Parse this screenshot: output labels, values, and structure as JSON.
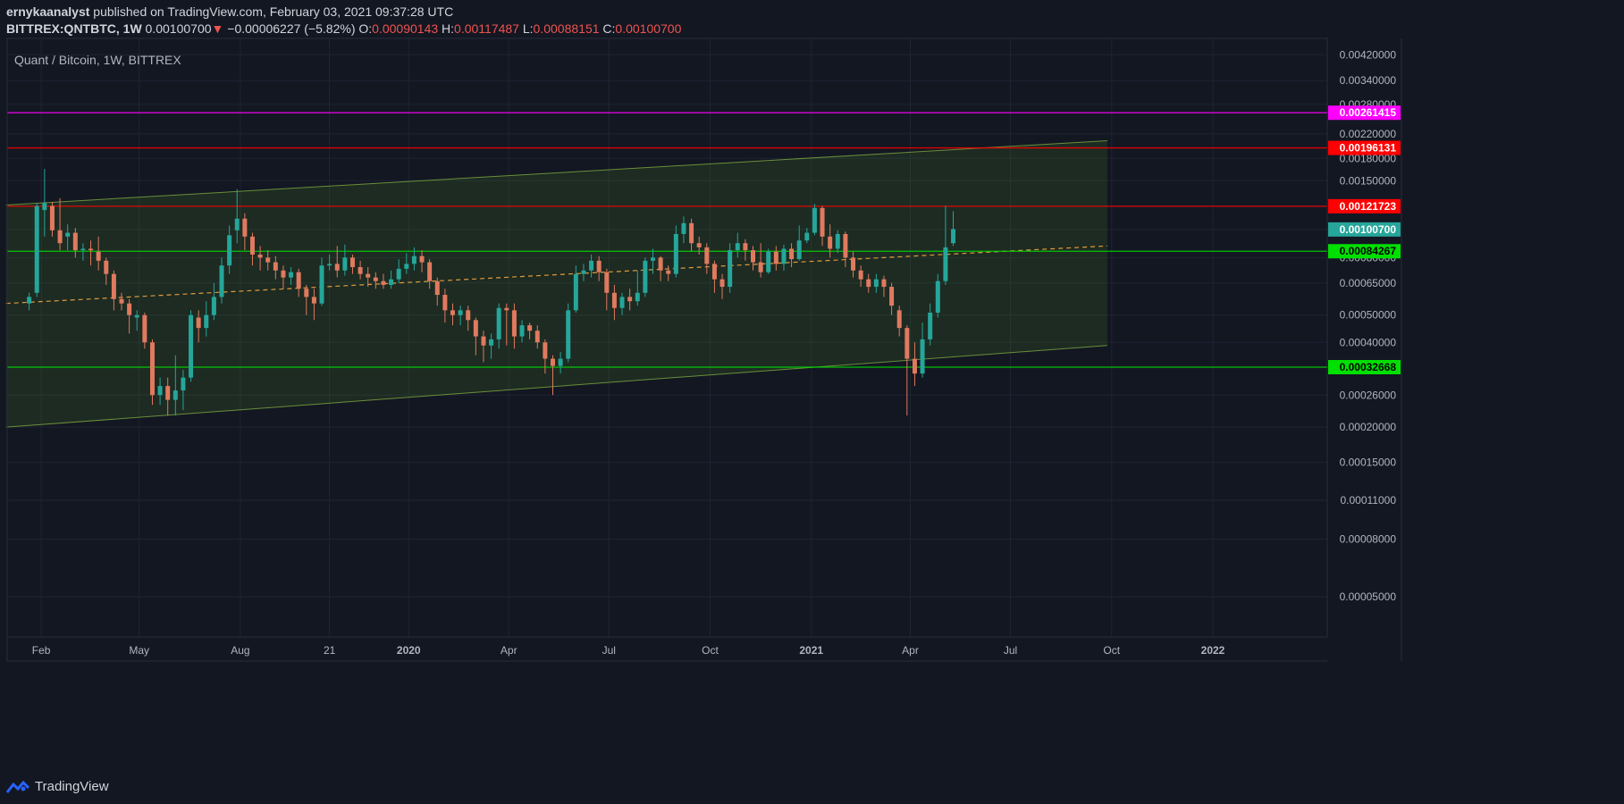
{
  "header": {
    "author": "ernykaanalyst",
    "published_text": "published on TradingView.com, February 03, 2021 09:37:28 UTC",
    "symbol": "BITTREX:QNTBTC, 1W",
    "last": "0.00100700",
    "change": "−0.00006227 (−5.82%)",
    "o_label": "O:",
    "o": "0.00090143",
    "h_label": "H:",
    "h": "0.00117487",
    "l_label": "L:",
    "l": "0.00088151",
    "c_label": "C:",
    "c": "0.00100700"
  },
  "chart_title": "Quant / Bitcoin, 1W, BITTREX",
  "footer": {
    "brand": "TradingView"
  },
  "colors": {
    "bg": "#131722",
    "up": "#26a69a",
    "down": "#e07a5f",
    "grid": "#1f2433",
    "text": "#b2b5be",
    "channel": "#6a8f3a",
    "mid": "#e09b3d",
    "magenta": "#ff00ff",
    "red": "#ff0000",
    "green": "#00e000",
    "price": "#26a69a"
  },
  "chart_data": {
    "type": "candlestick",
    "scale": "log",
    "ylim": [
      3.6e-05,
      0.0048
    ],
    "ylabels": [
      "0.00420000",
      "0.00340000",
      "0.00280000",
      "0.00220000",
      "0.00180000",
      "0.00150000",
      "0.00121723",
      "0.00100700",
      "0.00080000",
      "0.00065000",
      "0.00050000",
      "0.00040000",
      "0.00032668",
      "0.00026000",
      "0.00020000",
      "0.00015000",
      "0.00011000",
      "0.00008000",
      "0.00005000"
    ],
    "xaxis": {
      "range": [
        "2019-01-01",
        "2022-04-15"
      ],
      "ticks": [
        {
          "label": "Feb",
          "date": "2019-02-01",
          "bold": false
        },
        {
          "label": "May",
          "date": "2019-05-01",
          "bold": false
        },
        {
          "label": "Aug",
          "date": "2019-08-01",
          "bold": false
        },
        {
          "label": "21",
          "date": "2019-10-21",
          "bold": false
        },
        {
          "label": "2020",
          "date": "2020-01-01",
          "bold": true
        },
        {
          "label": "Apr",
          "date": "2020-04-01",
          "bold": false
        },
        {
          "label": "Jul",
          "date": "2020-07-01",
          "bold": false
        },
        {
          "label": "Oct",
          "date": "2020-10-01",
          "bold": false
        },
        {
          "label": "2021",
          "date": "2021-01-01",
          "bold": true
        },
        {
          "label": "Apr",
          "date": "2021-04-01",
          "bold": false
        },
        {
          "label": "Jul",
          "date": "2021-07-01",
          "bold": false
        },
        {
          "label": "Oct",
          "date": "2021-10-01",
          "bold": false
        },
        {
          "label": "2022",
          "date": "2022-01-01",
          "bold": true
        }
      ]
    },
    "levels": [
      {
        "value": 0.00261415,
        "label": "0.00261415",
        "color": "#ff00ff"
      },
      {
        "value": 0.00196131,
        "label": "0.00196131",
        "color": "#ff0000"
      },
      {
        "value": 0.00121723,
        "label": "0.00121723",
        "color": "#ff0000"
      },
      {
        "value": 0.00084267,
        "label": "0.00084267",
        "color": "#00e000"
      },
      {
        "value": 0.00032668,
        "label": "0.00032668",
        "color": "#00e000"
      }
    ],
    "current_price": {
      "value": 0.001007,
      "label": "0.00100700"
    },
    "channel": {
      "start": "2018-12-31",
      "end": "2021-09-27",
      "upper": [
        0.00123,
        0.00208
      ],
      "lower": [
        0.0002,
        0.00039
      ],
      "mid": [
        0.00055,
        0.00088
      ]
    },
    "candles_start": "2019-01-21",
    "candles": [
      [
        0.00055,
        0.00058,
        0.00052,
        0.0006
      ],
      [
        0.0006,
        0.00122,
        0.00058,
        0.00125
      ],
      [
        0.00118,
        0.00125,
        0.00095,
        0.00165
      ],
      [
        0.00122,
        0.001,
        0.00095,
        0.00126
      ],
      [
        0.001,
        0.0009,
        0.00085,
        0.0013
      ],
      [
        0.00095,
        0.00098,
        0.00085,
        0.00105
      ],
      [
        0.00098,
        0.00085,
        0.0008,
        0.00102
      ],
      [
        0.00085,
        0.00086,
        0.00078,
        0.0009
      ],
      [
        0.00086,
        0.00085,
        0.00075,
        0.00092
      ],
      [
        0.00084,
        0.00078,
        0.00072,
        0.00095
      ],
      [
        0.00078,
        0.0007,
        0.00064,
        0.0008
      ],
      [
        0.0007,
        0.00057,
        0.00052,
        0.00072
      ],
      [
        0.00057,
        0.00055,
        0.00052,
        0.0006
      ],
      [
        0.00055,
        0.0005,
        0.00043,
        0.00057
      ],
      [
        0.00049,
        0.0005,
        0.00044,
        0.00052
      ],
      [
        0.0005,
        0.0004,
        0.00038,
        0.00051
      ],
      [
        0.0004,
        0.00026,
        0.00024,
        0.00041
      ],
      [
        0.00026,
        0.00028,
        0.00024,
        0.0003
      ],
      [
        0.00028,
        0.00025,
        0.00022,
        0.0003
      ],
      [
        0.00025,
        0.00027,
        0.00022,
        0.00036
      ],
      [
        0.00027,
        0.0003,
        0.00023,
        0.00032
      ],
      [
        0.0003,
        0.0005,
        0.00029,
        0.00052
      ],
      [
        0.00049,
        0.00045,
        0.0004,
        0.00052
      ],
      [
        0.00045,
        0.0005,
        0.00042,
        0.00056
      ],
      [
        0.0005,
        0.00058,
        0.00048,
        0.00065
      ],
      [
        0.00058,
        0.00075,
        0.00055,
        0.0008
      ],
      [
        0.00075,
        0.00096,
        0.0007,
        0.00104
      ],
      [
        0.001,
        0.0011,
        0.0009,
        0.0014
      ],
      [
        0.0011,
        0.00095,
        0.00085,
        0.00115
      ],
      [
        0.00095,
        0.00082,
        0.00075,
        0.00098
      ],
      [
        0.00082,
        0.0008,
        0.00072,
        0.00088
      ],
      [
        0.0008,
        0.00077,
        0.00072,
        0.00085
      ],
      [
        0.00077,
        0.00072,
        0.00067,
        0.00081
      ],
      [
        0.00072,
        0.00068,
        0.00062,
        0.00075
      ],
      [
        0.00068,
        0.00071,
        0.00064,
        0.00074
      ],
      [
        0.00071,
        0.00062,
        0.00058,
        0.00073
      ],
      [
        0.00062,
        0.00058,
        0.0005,
        0.00064
      ],
      [
        0.00058,
        0.00055,
        0.00048,
        0.00062
      ],
      [
        0.00055,
        0.00075,
        0.00054,
        0.0008
      ],
      [
        0.00075,
        0.00076,
        0.00072,
        0.00082
      ],
      [
        0.00076,
        0.00072,
        0.00068,
        0.00088
      ],
      [
        0.00072,
        0.0008,
        0.00069,
        0.00089
      ],
      [
        0.0008,
        0.00074,
        0.0007,
        0.00082
      ],
      [
        0.00074,
        0.0007,
        0.00067,
        0.00078
      ],
      [
        0.0007,
        0.00068,
        0.00063,
        0.00074
      ],
      [
        0.00068,
        0.00066,
        0.00062,
        0.00071
      ],
      [
        0.00066,
        0.00064,
        0.00062,
        0.0007
      ],
      [
        0.00064,
        0.00067,
        0.00062,
        0.00072
      ],
      [
        0.00067,
        0.00073,
        0.00065,
        0.00079
      ],
      [
        0.00073,
        0.00076,
        0.0007,
        0.00083
      ],
      [
        0.00076,
        0.00081,
        0.00072,
        0.00087
      ],
      [
        0.00081,
        0.00077,
        0.00071,
        0.00085
      ],
      [
        0.00077,
        0.00066,
        0.00062,
        0.00079
      ],
      [
        0.00066,
        0.00059,
        0.00054,
        0.00068
      ],
      [
        0.00059,
        0.00052,
        0.00047,
        0.00062
      ],
      [
        0.00052,
        0.0005,
        0.00046,
        0.00055
      ],
      [
        0.0005,
        0.00052,
        0.00046,
        0.00054
      ],
      [
        0.00052,
        0.00048,
        0.00044,
        0.00054
      ],
      [
        0.00048,
        0.00042,
        0.00036,
        0.00049
      ],
      [
        0.00042,
        0.00039,
        0.00034,
        0.00044
      ],
      [
        0.00039,
        0.00041,
        0.00035,
        0.00043
      ],
      [
        0.00041,
        0.00053,
        0.00038,
        0.00055
      ],
      [
        0.00053,
        0.00052,
        0.00039,
        0.00055
      ],
      [
        0.00052,
        0.00042,
        0.00038,
        0.00055
      ],
      [
        0.00042,
        0.00046,
        0.0004,
        0.00048
      ],
      [
        0.00046,
        0.00044,
        0.00041,
        0.00047
      ],
      [
        0.00044,
        0.0004,
        0.00038,
        0.00046
      ],
      [
        0.0004,
        0.00035,
        0.00031,
        0.00041
      ],
      [
        0.00035,
        0.00033,
        0.00026,
        0.00036
      ],
      [
        0.00033,
        0.00035,
        0.00031,
        0.00037
      ],
      [
        0.00035,
        0.00052,
        0.00034,
        0.00055
      ],
      [
        0.00052,
        0.0007,
        0.00051,
        0.00075
      ],
      [
        0.0007,
        0.00072,
        0.00066,
        0.00076
      ],
      [
        0.00072,
        0.00078,
        0.00068,
        0.00082
      ],
      [
        0.00078,
        0.00071,
        0.00066,
        0.00081
      ],
      [
        0.00071,
        0.0006,
        0.00052,
        0.00073
      ],
      [
        0.0006,
        0.00053,
        0.00048,
        0.00064
      ],
      [
        0.00053,
        0.00058,
        0.0005,
        0.0006
      ],
      [
        0.00058,
        0.00056,
        0.00052,
        0.00062
      ],
      [
        0.00056,
        0.0006,
        0.00054,
        0.00072
      ],
      [
        0.0006,
        0.00078,
        0.00058,
        0.0008
      ],
      [
        0.00078,
        0.0008,
        0.0007,
        0.00086
      ],
      [
        0.0008,
        0.00072,
        0.00066,
        0.00081
      ],
      [
        0.00072,
        0.0007,
        0.00066,
        0.00075
      ],
      [
        0.0007,
        0.00097,
        0.00068,
        0.00104
      ],
      [
        0.00097,
        0.00106,
        0.0009,
        0.00112
      ],
      [
        0.00106,
        0.0009,
        0.00084,
        0.0011
      ],
      [
        0.0009,
        0.00087,
        0.00082,
        0.00095
      ],
      [
        0.00087,
        0.00076,
        0.0007,
        0.0009
      ],
      [
        0.00076,
        0.00067,
        0.0006,
        0.00078
      ],
      [
        0.00067,
        0.00063,
        0.00057,
        0.0007
      ],
      [
        0.00063,
        0.00085,
        0.0006,
        0.0009
      ],
      [
        0.00085,
        0.0009,
        0.0008,
        0.00098
      ],
      [
        0.0009,
        0.00085,
        0.00078,
        0.00093
      ],
      [
        0.00085,
        0.00077,
        0.00072,
        0.00088
      ],
      [
        0.00077,
        0.00071,
        0.00068,
        0.0009
      ],
      [
        0.00071,
        0.00084,
        0.0007,
        0.00086
      ],
      [
        0.00084,
        0.00076,
        0.00072,
        0.00088
      ],
      [
        0.00076,
        0.00086,
        0.00072,
        0.00089
      ],
      [
        0.00086,
        0.00079,
        0.00074,
        0.0009
      ],
      [
        0.00079,
        0.00092,
        0.00078,
        0.00104
      ],
      [
        0.00092,
        0.00098,
        0.0009,
        0.00102
      ],
      [
        0.00098,
        0.0012,
        0.00096,
        0.00124
      ],
      [
        0.0012,
        0.00095,
        0.00088,
        0.00122
      ],
      [
        0.00095,
        0.00086,
        0.0008,
        0.00105
      ],
      [
        0.00086,
        0.00097,
        0.00083,
        0.001
      ],
      [
        0.00097,
        0.0008,
        0.00074,
        0.00099
      ],
      [
        0.0008,
        0.00072,
        0.00068,
        0.00084
      ],
      [
        0.00072,
        0.00067,
        0.00063,
        0.00075
      ],
      [
        0.00067,
        0.00063,
        0.0006,
        0.0007
      ],
      [
        0.00063,
        0.00067,
        0.0006,
        0.0007
      ],
      [
        0.00067,
        0.00063,
        0.00058,
        0.00069
      ],
      [
        0.00063,
        0.00054,
        0.0005,
        0.00065
      ],
      [
        0.00052,
        0.00045,
        0.00042,
        0.00054
      ],
      [
        0.00045,
        0.00035,
        0.00022,
        0.00046
      ],
      [
        0.00035,
        0.00031,
        0.00028,
        0.0004
      ],
      [
        0.00031,
        0.00041,
        0.0003,
        0.00047
      ],
      [
        0.00041,
        0.00051,
        0.00039,
        0.00055
      ],
      [
        0.00051,
        0.00066,
        0.00049,
        0.0007
      ],
      [
        0.00066,
        0.00087,
        0.00064,
        0.00122
      ],
      [
        0.0009,
        0.00101,
        0.00088,
        0.00117
      ]
    ]
  }
}
